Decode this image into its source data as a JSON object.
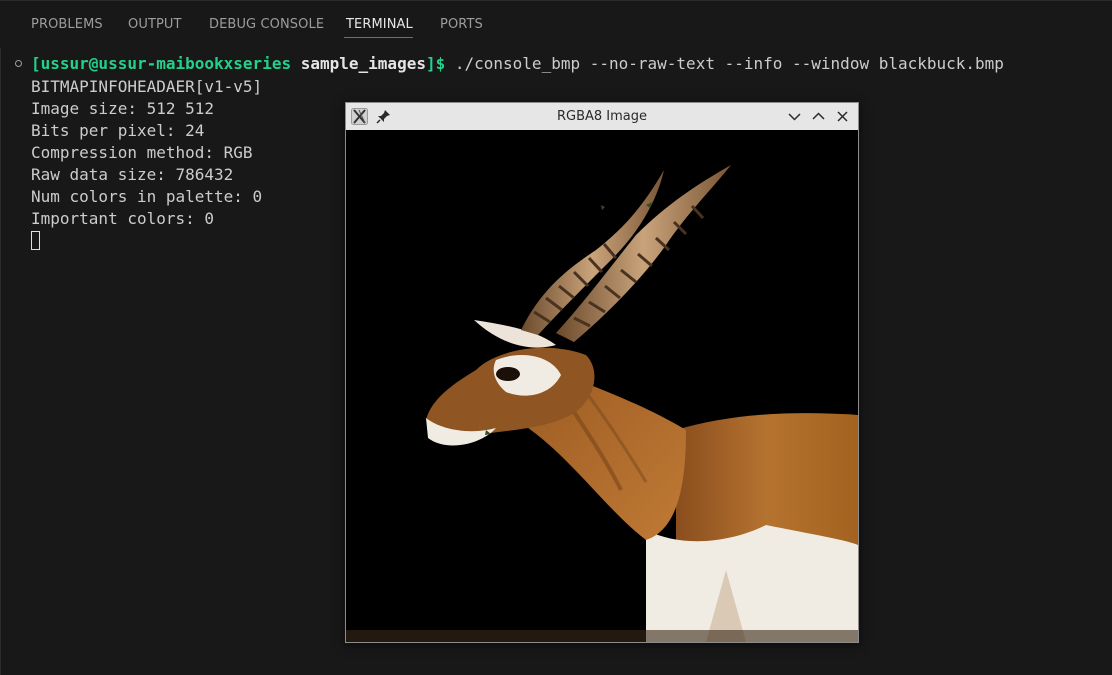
{
  "panel": {
    "tabs": [
      {
        "label": "PROBLEMS"
      },
      {
        "label": "OUTPUT"
      },
      {
        "label": "DEBUG CONSOLE"
      },
      {
        "label": "TERMINAL"
      },
      {
        "label": "PORTS"
      }
    ],
    "active_tab": "TERMINAL",
    "accent_color": "#2f7bd4"
  },
  "terminal": {
    "prompt_user_host": "[ussur@ussur-maibookxseries",
    "prompt_dir": "sample_images",
    "prompt_end": "]$",
    "command": " ./console_bmp --no-raw-text --info --window blackbuck.bmp",
    "output": [
      "BITMAPINFOHEADAER[v1-v5]",
      "Image size: 512 512",
      "Bits per pixel: 24",
      "Compression method: RGB",
      "Raw data size: 786432",
      "Num colors in palette: 0",
      "Important colors: 0"
    ],
    "prompt_color": "#23d18b"
  },
  "image_window": {
    "title": "RGBA8 Image",
    "icons": [
      "x11-app-icon",
      "pin-icon",
      "minimize-icon",
      "maximize-icon",
      "close-icon"
    ],
    "content": "blackbuck antelope photograph"
  }
}
